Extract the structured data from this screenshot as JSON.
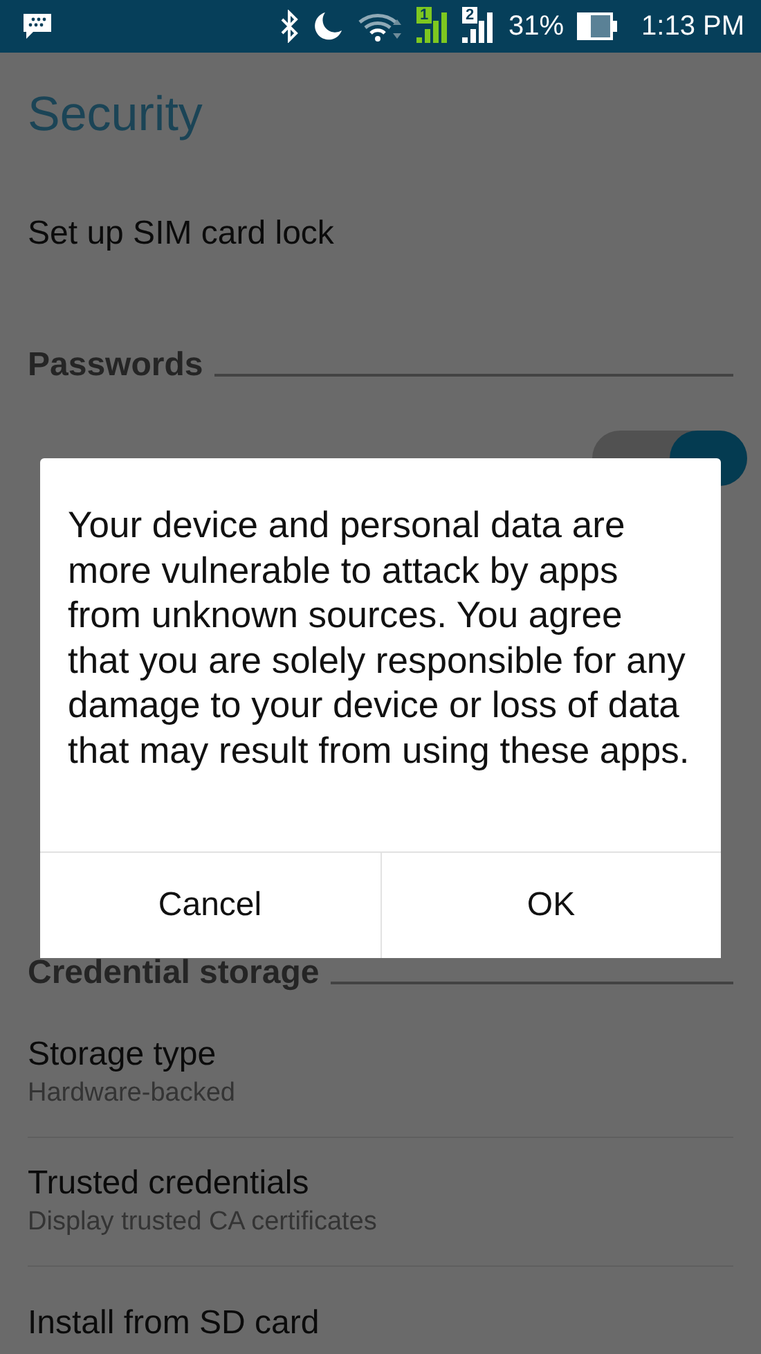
{
  "status_bar": {
    "sim_labels": [
      "1",
      "2"
    ],
    "battery": "31%",
    "time": "1:13 PM"
  },
  "title": "Security",
  "items": [
    {
      "kind": "row",
      "title": "Set up SIM card lock"
    },
    {
      "kind": "header",
      "title": "Passwords"
    },
    {
      "kind": "switch",
      "on": true
    },
    {
      "kind": "covered"
    },
    {
      "kind": "header",
      "title": "Credential storage"
    },
    {
      "kind": "row",
      "title": "Storage type",
      "subtitle": [
        "Hardware-backed"
      ]
    },
    {
      "kind": "row",
      "title": "Trusted credentials",
      "subtitle": [
        "Display trusted CA certificates"
      ]
    },
    {
      "kind": "row",
      "title": "Install from SD card"
    }
  ],
  "dialog": {
    "message": "Your device and personal data are more vulnerable to attack by apps from unknown sources. You agree that you are solely responsible for any damage to your device or loss of data that may result from using these apps.",
    "buttons": [
      "Cancel",
      "OK"
    ]
  }
}
